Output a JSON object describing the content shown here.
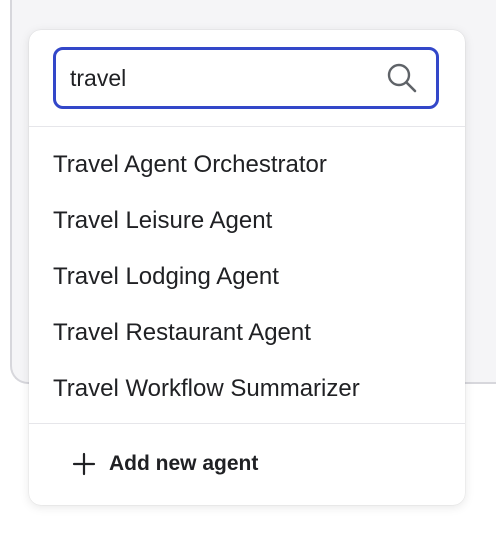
{
  "search": {
    "value": "travel",
    "icon": "search-icon"
  },
  "results": [
    {
      "label": "Travel Agent Orchestrator"
    },
    {
      "label": "Travel Leisure Agent"
    },
    {
      "label": "Travel Lodging Agent"
    },
    {
      "label": "Travel Restaurant Agent"
    },
    {
      "label": "Travel Workflow Summarizer"
    }
  ],
  "footer": {
    "add_label": "Add new agent",
    "icon": "plus-icon"
  },
  "colors": {
    "focus_border": "#3347c9",
    "text": "#202124",
    "divider": "#e6e6ea"
  }
}
